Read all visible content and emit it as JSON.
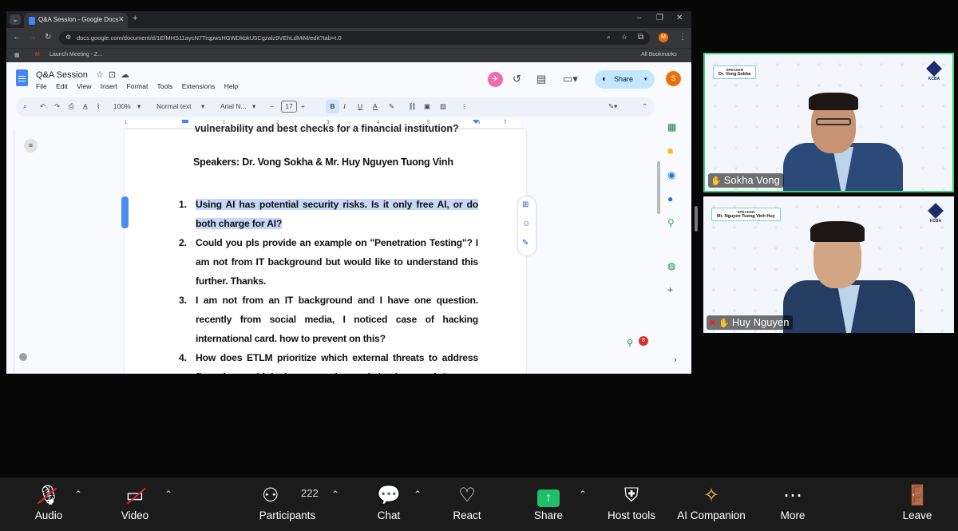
{
  "browser": {
    "tab_title": "Q&A Session - Google Docs",
    "url": "docs.google.com/document/d/1EfMHS11aycN7TrqpwsHGWDkbkU5Cgzalz9VEhLdMiM/edit?tab=t.0",
    "bookmarks": [
      "Launch Meeting - Z...",
      "All Bookmarks"
    ],
    "profile_initial": "M"
  },
  "docs": {
    "title": "Q&A Session",
    "menu": [
      "File",
      "Edit",
      "View",
      "Insert",
      "Format",
      "Tools",
      "Extensions",
      "Help"
    ],
    "share_label": "Share",
    "user_initial": "S",
    "toolbar": {
      "zoom": "100%",
      "style": "Normal text",
      "font": "Arial N...",
      "font_size": "17"
    },
    "ruler_marks": [
      "1",
      "1",
      "2",
      "3",
      "4",
      "5",
      "6",
      "7"
    ],
    "prev_line": "vulnerability and best checks for a financial institution?",
    "speakers": "Speakers: Dr. Vong Sokha &  Mr. Huy Nguyen Tuong Vinh",
    "questions": [
      {
        "n": "1.",
        "text": "Using AI has potential security risks. Is it only free AI, or do both charge for AI?"
      },
      {
        "n": "2.",
        "text": "Could you pls provide an example on \"Penetration Testing\"? I am not from IT background but would like to understand this further. Thanks."
      },
      {
        "n": "3.",
        "text": "I am not from an IT background and I have one question. recently from social media, I noticed case of hacking international card. how to prevent on this?"
      },
      {
        "n": "4.",
        "text": "How does ETLM prioritize which external threats to address first when multiple threats are detected simultaneously?"
      }
    ],
    "notification_count": "8"
  },
  "participants_tiles": [
    {
      "name": "Sokha Vong",
      "speaker_header": "SPEAKER",
      "speaker_name": "Dr. Vong Sokha",
      "logo_text": "KCBA"
    },
    {
      "name": "Huy Nguyen",
      "speaker_header": "SPEAKER",
      "speaker_name": "Mr. Nguyen Tuong Vinh Huy",
      "logo_text": "KCBA"
    }
  ],
  "zoom_bar": {
    "audio": "Audio",
    "video": "Video",
    "participants": "Participants",
    "participant_count": "222",
    "chat": "Chat",
    "react": "React",
    "share": "Share",
    "host_tools": "Host tools",
    "ai_companion": "AI Companion",
    "more": "More",
    "leave": "Leave"
  }
}
